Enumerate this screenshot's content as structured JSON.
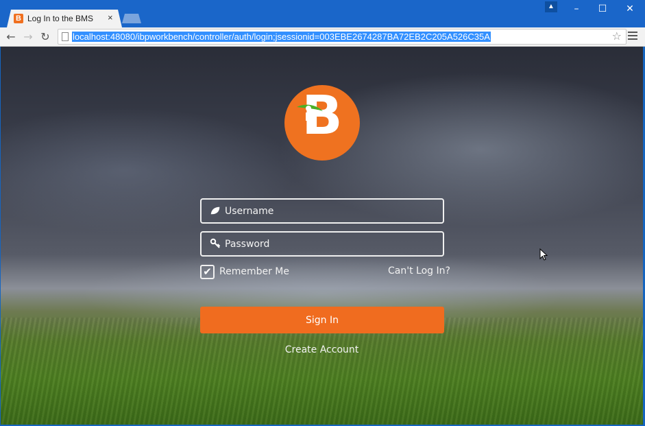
{
  "browser": {
    "tab_title": "Log In to the BMS",
    "tab_favicon_letter": "B",
    "tab_close": "×",
    "url": "localhost:48080/ibpworkbench/controller/auth/login;jsessionid=003EBE2674287BA72EB2C205A526C35A",
    "window_controls": {
      "minimize": "–",
      "maximize": "☐",
      "close": "✕"
    },
    "nav": {
      "back": "←",
      "forward": "→",
      "reload": "↻",
      "star": "☆"
    }
  },
  "login": {
    "logo_letter": "B",
    "username_placeholder": "Username",
    "password_placeholder": "Password",
    "remember_label": "Remember Me",
    "remember_checked": true,
    "checkmark": "✔",
    "cant_login": "Can't Log In?",
    "signin_label": "Sign In",
    "create_account": "Create Account"
  },
  "colors": {
    "brand_orange": "#ef7220",
    "titlebar_blue": "#1a66c9",
    "url_highlight": "#3390ff"
  },
  "icons": {
    "username_field": "leaf-icon",
    "password_field": "key-icon"
  }
}
